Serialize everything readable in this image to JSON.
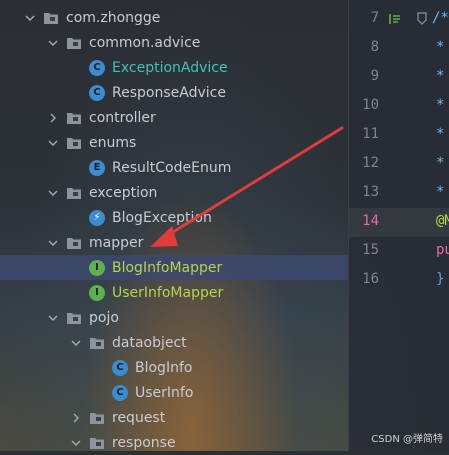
{
  "tree": [
    {
      "label": "com.zhongge",
      "type": "folder",
      "indent": 1,
      "expanded": true
    },
    {
      "label": "common.advice",
      "type": "folder",
      "indent": 2,
      "expanded": true
    },
    {
      "label": "ExceptionAdvice",
      "type": "class",
      "indent": 3,
      "color": "teal"
    },
    {
      "label": "ResponseAdvice",
      "type": "class",
      "indent": 3
    },
    {
      "label": "controller",
      "type": "folder",
      "indent": 2,
      "expanded": false
    },
    {
      "label": "enums",
      "type": "folder",
      "indent": 2,
      "expanded": true
    },
    {
      "label": "ResultCodeEnum",
      "type": "enum",
      "indent": 3
    },
    {
      "label": "exception",
      "type": "folder",
      "indent": 2,
      "expanded": true
    },
    {
      "label": "BlogException",
      "type": "exception",
      "indent": 3
    },
    {
      "label": "mapper",
      "type": "folder",
      "indent": 2,
      "expanded": true
    },
    {
      "label": "BlogInfoMapper",
      "type": "interface",
      "indent": 3,
      "color": "green",
      "selected": true
    },
    {
      "label": "UserInfoMapper",
      "type": "interface",
      "indent": 3,
      "color": "green"
    },
    {
      "label": "pojo",
      "type": "folder",
      "indent": 2,
      "expanded": true
    },
    {
      "label": "dataobject",
      "type": "folder",
      "indent": 3,
      "expanded": true
    },
    {
      "label": "BlogInfo",
      "type": "class",
      "indent": 4
    },
    {
      "label": "UserInfo",
      "type": "class",
      "indent": 4
    },
    {
      "label": "request",
      "type": "folder",
      "indent": 3,
      "expanded": false
    },
    {
      "label": "response",
      "type": "folder",
      "indent": 3,
      "expanded": true
    }
  ],
  "editor": {
    "line_numbers": [
      "7",
      "8",
      "9",
      "10",
      "11",
      "12",
      "13",
      "14",
      "15",
      "16"
    ],
    "current_line": "14",
    "fragments": {
      "line7": "/*",
      "line8": "*",
      "line9": "*",
      "line10": "*",
      "line11": "*",
      "line12": "*",
      "line13": "*",
      "line14": "@M",
      "line15": "pu",
      "line16": "}"
    }
  },
  "watermark": "CSDN @弹简特",
  "colors": {
    "teal": "#41c2b5",
    "green": "#b7d44a",
    "arrow": "#e23b3b",
    "line_current": "#e86aa6"
  }
}
